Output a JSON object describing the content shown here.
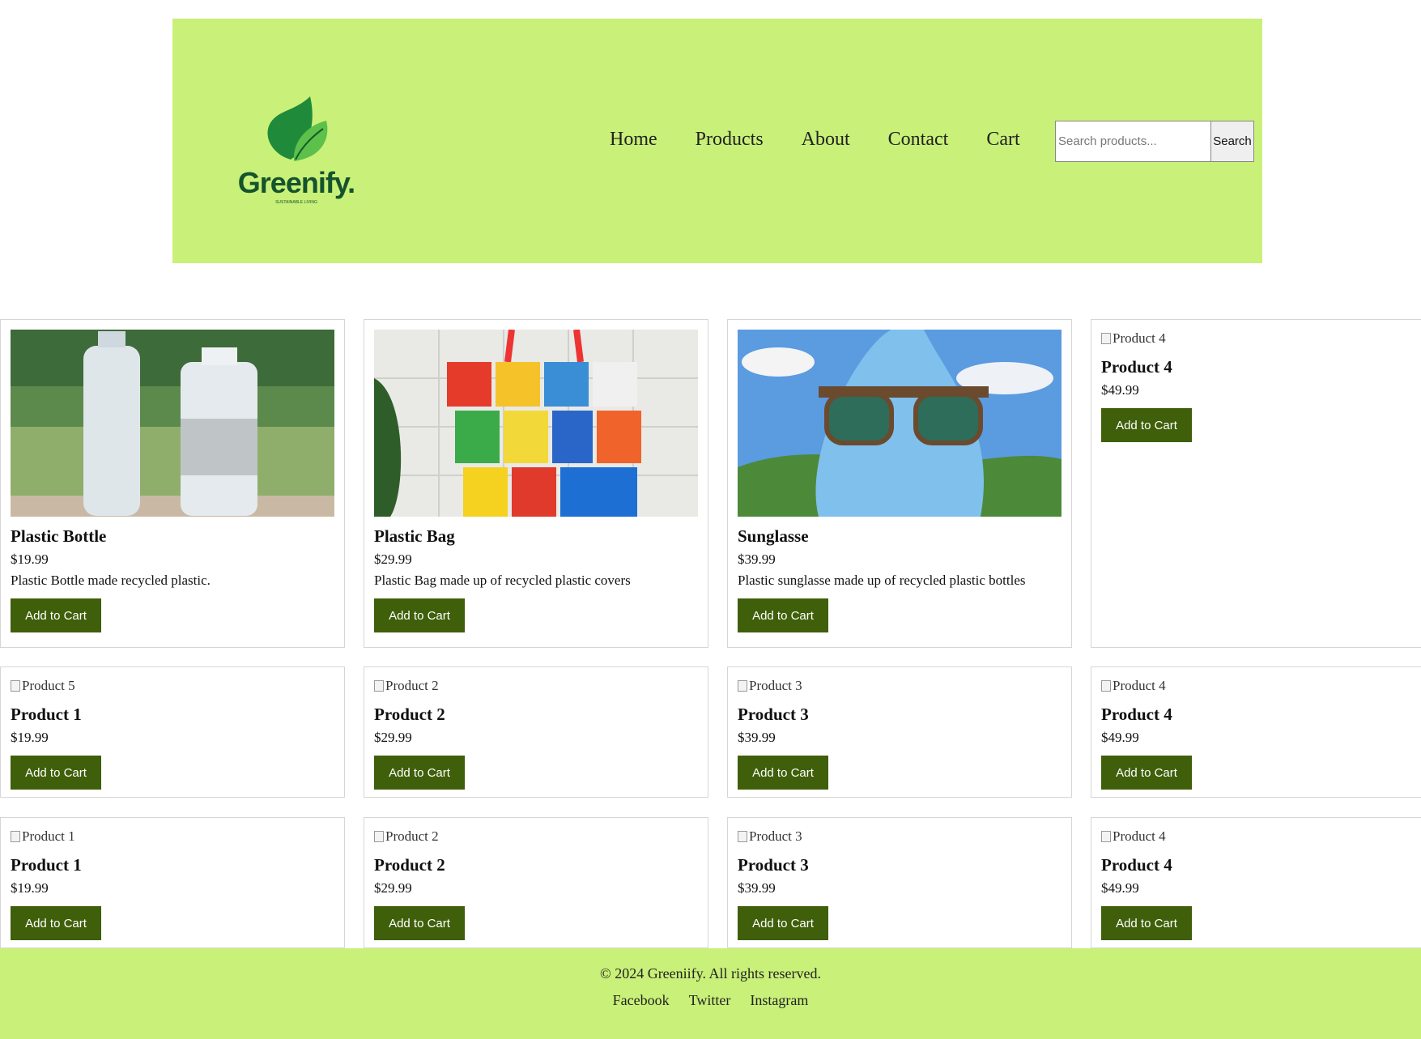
{
  "brand": {
    "name": "Greenify.",
    "tagline": "SUSTAINABLE LIVING"
  },
  "nav": {
    "items": [
      "Home",
      "Products",
      "About",
      "Contact",
      "Cart"
    ]
  },
  "search": {
    "placeholder": "Search products...",
    "button_label": "Search"
  },
  "colors": {
    "header_bg": "#c9f078",
    "button_bg": "#3f5f0a",
    "button_text": "#ffffff"
  },
  "products": [
    {
      "name": "Plastic Bottle",
      "price": "$19.99",
      "description": "Plastic Bottle made recycled plastic.",
      "image": "plastic-bottle-photo",
      "button_label": "Add to Cart"
    },
    {
      "name": "Plastic Bag",
      "price": "$29.99",
      "description": "Plastic Bag made up of recycled plastic covers",
      "image": "plastic-bag-photo",
      "button_label": "Add to Cart"
    },
    {
      "name": "Sunglasse",
      "price": "$39.99",
      "description": "Plastic sunglasse made up of recycled plastic bottles",
      "image": "sunglasses-photo",
      "button_label": "Add to Cart"
    },
    {
      "name": "Product 4",
      "price": "$49.99",
      "alt": "Product 4",
      "button_label": "Add to Cart"
    },
    {
      "name": "Product 1",
      "price": "$19.99",
      "alt": "Product 5",
      "button_label": "Add to Cart"
    },
    {
      "name": "Product 2",
      "price": "$29.99",
      "alt": "Product 2",
      "button_label": "Add to Cart"
    },
    {
      "name": "Product 3",
      "price": "$39.99",
      "alt": "Product 3",
      "button_label": "Add to Cart"
    },
    {
      "name": "Product 4",
      "price": "$49.99",
      "alt": "Product 4",
      "button_label": "Add to Cart"
    },
    {
      "name": "Product 1",
      "price": "$19.99",
      "alt": "Product 1",
      "button_label": "Add to Cart"
    },
    {
      "name": "Product 2",
      "price": "$29.99",
      "alt": "Product 2",
      "button_label": "Add to Cart"
    },
    {
      "name": "Product 3",
      "price": "$39.99",
      "alt": "Product 3",
      "button_label": "Add to Cart"
    },
    {
      "name": "Product 4",
      "price": "$49.99",
      "alt": "Product 4",
      "button_label": "Add to Cart"
    }
  ],
  "footer": {
    "copyright": "© 2024 Greeniify. All rights reserved.",
    "links": [
      "Facebook",
      "Twitter",
      "Instagram"
    ]
  }
}
